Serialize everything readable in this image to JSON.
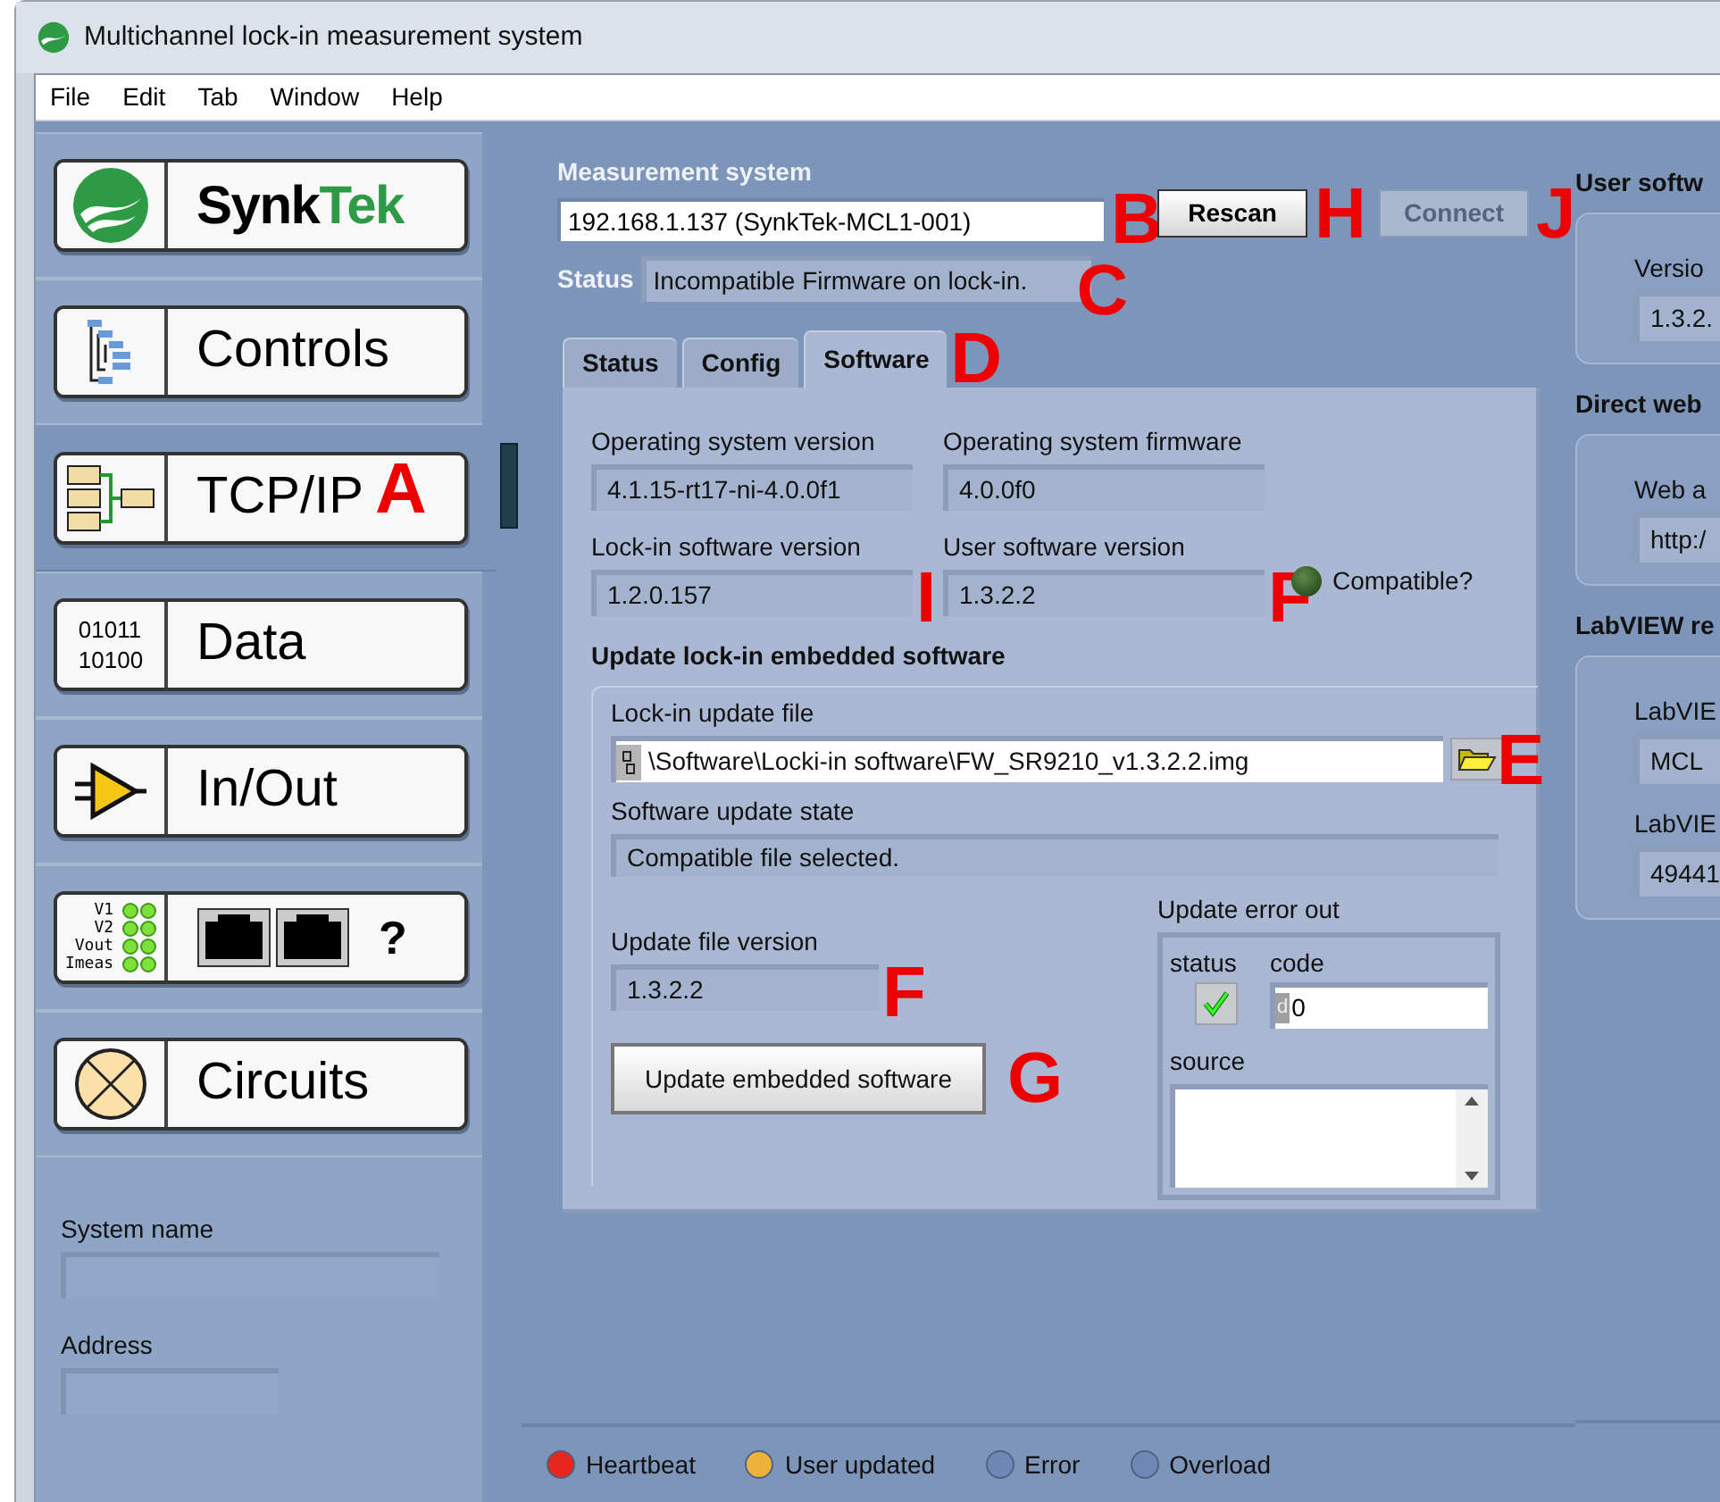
{
  "window": {
    "title": "Multichannel lock-in measurement system"
  },
  "menu": [
    "File",
    "Edit",
    "Tab",
    "Window",
    "Help"
  ],
  "nav": [
    {
      "kind": "logo",
      "label": "Synk",
      "label_accent": "Tek",
      "selected": false
    },
    {
      "kind": "tree",
      "label": "Controls",
      "selected": false
    },
    {
      "kind": "network",
      "label": "TCP/IP",
      "selected": true,
      "marker": "A"
    },
    {
      "kind": "binary",
      "label": "Data",
      "icon_text": [
        "01011",
        "10100"
      ],
      "selected": false
    },
    {
      "kind": "amplifier",
      "label": "In/Out",
      "selected": false
    },
    {
      "kind": "ports",
      "label": "?",
      "icon_text": [
        "V1",
        "V2",
        "Vout",
        "Imeas"
      ],
      "selected": false
    },
    {
      "kind": "lamp",
      "label": "Circuits",
      "selected": false
    }
  ],
  "sidebar_fields": [
    {
      "label": "System name"
    },
    {
      "label": "Address"
    }
  ],
  "measurement": {
    "label": "Measurement system",
    "value": "192.168.1.137 (SynkTek-MCL1-001)",
    "marker": "B"
  },
  "status": {
    "label": "Status",
    "value": "Incompatible Firmware on lock-in.",
    "marker": "C"
  },
  "buttons": [
    {
      "label": "Rescan",
      "disabled": false,
      "marker": "H"
    },
    {
      "label": "Connect",
      "disabled": true,
      "marker": "J"
    }
  ],
  "tabs": [
    {
      "label": "Status",
      "selected": false
    },
    {
      "label": "Config",
      "selected": false
    },
    {
      "label": "Software",
      "selected": true,
      "marker": "D"
    }
  ],
  "software": {
    "versions": [
      {
        "label": "Operating system version",
        "value": "4.1.15-rt17-ni-4.0.0f1"
      },
      {
        "label": "Operating system firmware",
        "value": "4.0.0f0"
      },
      {
        "label": "Lock-in software version",
        "value": "1.2.0.157",
        "marker": "I"
      },
      {
        "label": "User software version",
        "value": "1.3.2.2",
        "marker": "F"
      }
    ],
    "compatible": {
      "label": "Compatible?",
      "on": false
    },
    "update_title": "Update lock-in embedded software",
    "update_file": {
      "label": "Lock-in update file",
      "value": "\\Software\\Locki-in software\\FW_SR9210_v1.3.2.2.img",
      "marker": "E"
    },
    "update_state": {
      "label": "Software update state",
      "value": "Compatible file selected."
    },
    "update_version": {
      "label": "Update file version",
      "value": "1.3.2.2",
      "marker": "F"
    },
    "update_button": {
      "label": "Update embedded software",
      "marker": "G"
    },
    "error_out": {
      "title": "Update error out",
      "status_label": "status",
      "status_ok": true,
      "code_label": "code",
      "code_radix": "d",
      "code": "0",
      "source_label": "source"
    }
  },
  "right_groups": [
    {
      "title": "User softw",
      "fields": [
        {
          "label": "Versio",
          "value": "1.3.2."
        }
      ]
    },
    {
      "title": "Direct web",
      "fields": [
        {
          "label": "Web a",
          "value": "http:/"
        }
      ]
    },
    {
      "title": "LabVIEW re",
      "fields": [
        {
          "label": "LabVIE",
          "value": "MCL"
        },
        {
          "label": "LabVIE",
          "value": "49441"
        }
      ]
    }
  ],
  "indicators": [
    {
      "label": "Heartbeat",
      "color": "#e8261c"
    },
    {
      "label": "User updated",
      "color": "#eeb23a"
    },
    {
      "label": "Error",
      "color": "#6e88b6"
    },
    {
      "label": "Overload",
      "color": "#6e88b6"
    }
  ]
}
